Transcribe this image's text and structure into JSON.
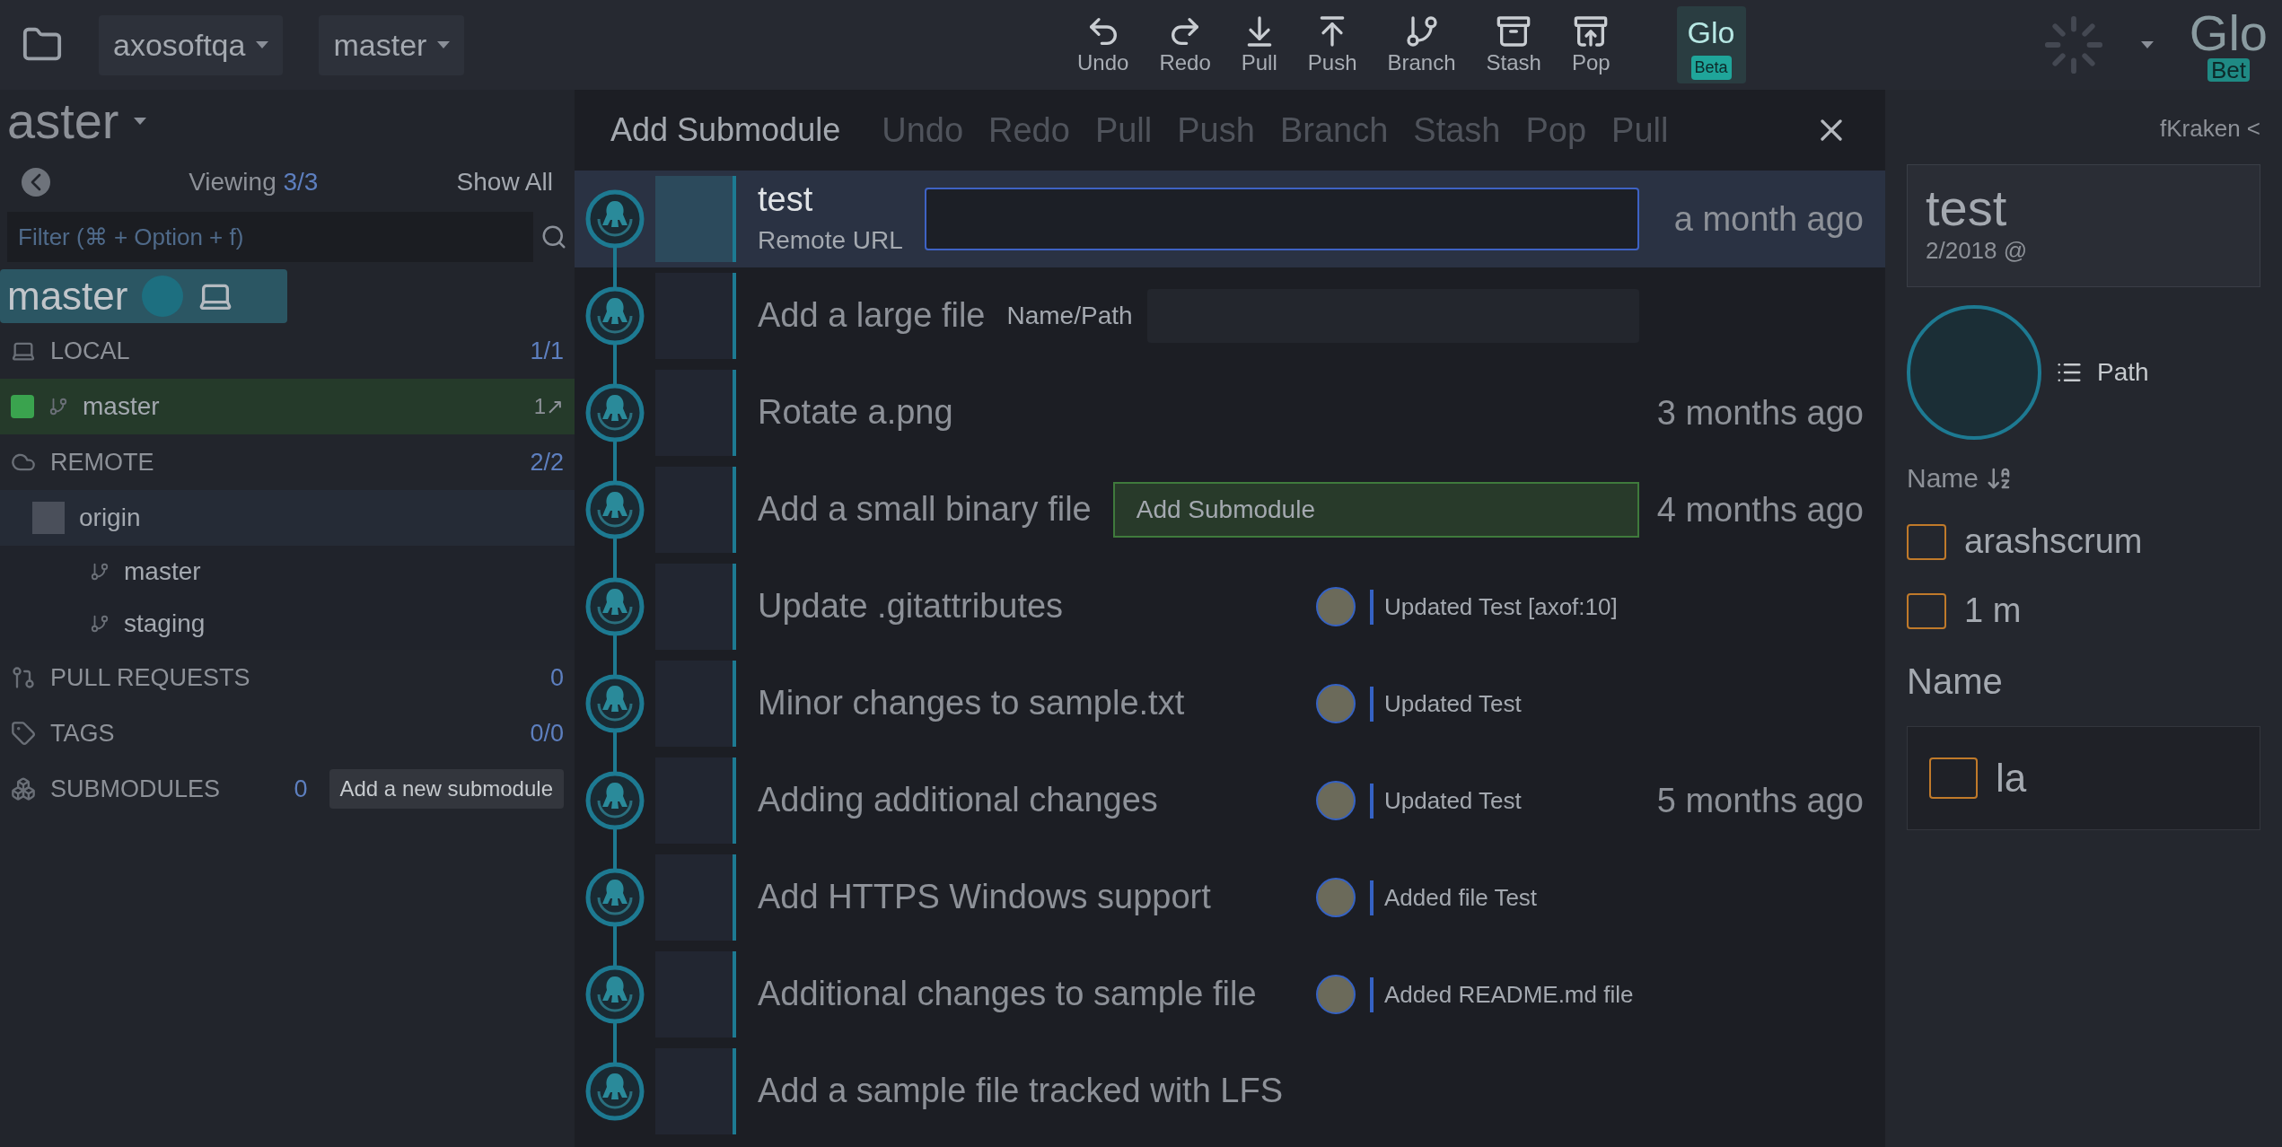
{
  "breadcrumbs": [
    {
      "label": "axosoftqa"
    },
    {
      "label": "master"
    }
  ],
  "toolbar": [
    {
      "kind": "undo",
      "label": "Undo"
    },
    {
      "kind": "redo",
      "label": "Redo"
    },
    {
      "kind": "pull",
      "label": "Pull"
    },
    {
      "kind": "push",
      "label": "Push"
    },
    {
      "kind": "branch",
      "label": "Branch"
    },
    {
      "kind": "stash",
      "label": "Stash"
    },
    {
      "kind": "pop",
      "label": "Pop"
    }
  ],
  "glo": {
    "label": "Glo",
    "badge": "Beta"
  },
  "glo_large": {
    "label": "Glo",
    "badge": "Bet"
  },
  "toolbar_large": [
    "Undo",
    "Redo",
    "Pull",
    "Push",
    "Branch",
    "Stash",
    "Pop",
    "Pull"
  ],
  "branch_ghost": "aster",
  "sidebar": {
    "viewing_label": "Viewing",
    "viewing_count": "3/3",
    "show_all": "Show All",
    "filter_placeholder": "Filter (⌘ + Option + f)",
    "current_branch": "master",
    "sections": [
      {
        "kind": "local",
        "label": "LOCAL",
        "count": "1/1",
        "items": [
          {
            "label": "master",
            "checked": true,
            "selected": true,
            "badge": "1↗"
          }
        ]
      },
      {
        "kind": "remote",
        "label": "REMOTE",
        "count": "2/2",
        "items": [
          {
            "label": "origin",
            "selected": false,
            "children": [
              {
                "label": "master",
                "selected": false
              },
              {
                "label": "staging",
                "selected": false
              }
            ]
          }
        ]
      },
      {
        "kind": "pull_requests",
        "label": "PULL REQUESTS",
        "count": "0"
      },
      {
        "kind": "tags",
        "label": "TAGS",
        "count": "0/0"
      },
      {
        "kind": "submodules",
        "label": "SUBMODULES",
        "count": "0",
        "tooltip": "Add a new submodule"
      }
    ]
  },
  "dialog": {
    "title": "Add Submodule",
    "remote_url_label": "Remote URL",
    "name_path_label": "Name/Path",
    "submit": "Add Submodule"
  },
  "commits": [
    {
      "message": "test",
      "time": "a month ago",
      "selected": true
    },
    {
      "message": "Add a large file",
      "selected": false
    },
    {
      "message": "Rotate a.png",
      "time": "3 months ago",
      "selected": false
    },
    {
      "message": "Add a small binary file",
      "time": "4 months ago",
      "selected": false
    },
    {
      "message": "Update .gitattributes",
      "selected": false,
      "sub": "Updated Test [axof:10]"
    },
    {
      "message": "Minor changes to sample.txt",
      "selected": false,
      "sub": "Updated Test"
    },
    {
      "message": "Adding additional changes",
      "time": "5 months ago",
      "selected": false,
      "sub": "Updated Test"
    },
    {
      "message": "Add HTTPS Windows support",
      "selected": false,
      "sub": "Added file Test"
    },
    {
      "message": "Additional changes to sample file",
      "selected": false,
      "sub": "Added README.md file"
    },
    {
      "message": "Add a sample file tracked with LFS",
      "selected": false
    }
  ],
  "right_panel": {
    "author": "fKraken <",
    "title": "test",
    "date": "2/2018 @",
    "path_label": "Path",
    "sort_label": "Name",
    "files": [
      {
        "label": "arashscrum"
      },
      {
        "label": "1 m"
      }
    ],
    "name_label": "Name",
    "last_file": "la"
  }
}
